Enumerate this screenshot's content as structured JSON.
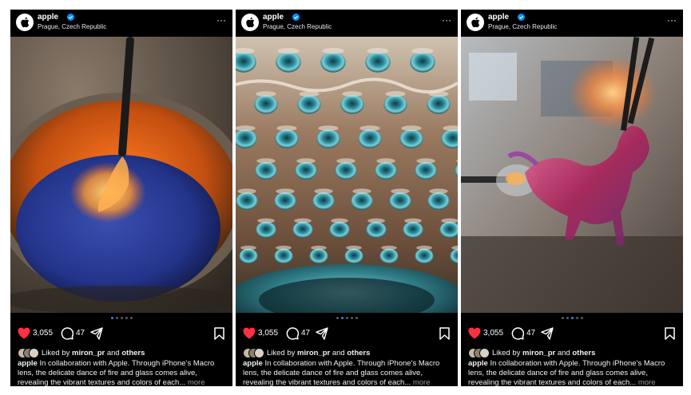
{
  "posts": [
    {
      "username": "apple",
      "location": "Prague, Czech Republic",
      "more_label": "···",
      "likes": "3,055",
      "comments": "47",
      "liked_prefix": "Liked by",
      "liked_user": "miron_pr",
      "liked_and": "and",
      "liked_others": "others",
      "caption_user": "apple",
      "caption_text": "In collaboration with Apple. Through iPhone’s Macro lens, the delicate dance of fire and glass comes alive, revealing the vibrant textures and colors of each...",
      "caption_more": "more",
      "photo": "molten-glass-in-blue-powder",
      "carousel_active": 1,
      "carousel_count": 5
    },
    {
      "username": "apple",
      "location": "Prague, Czech Republic",
      "more_label": "···",
      "likes": "3,055",
      "comments": "47",
      "liked_prefix": "Liked by",
      "liked_user": "miron_pr",
      "liked_and": "and",
      "liked_others": "others",
      "caption_user": "apple",
      "caption_text": "In collaboration with Apple. Through iPhone’s Macro lens, the delicate dance of fire and glass comes alive, revealing the vibrant textures and colors of each...",
      "caption_more": "more",
      "photo": "textured-glass-bubbles",
      "carousel_active": 2,
      "carousel_count": 5
    },
    {
      "username": "apple",
      "location": "Prague, Czech Republic",
      "more_label": "···",
      "likes": "3,055",
      "comments": "47",
      "liked_prefix": "Liked by",
      "liked_user": "miron_pr",
      "liked_and": "and",
      "liked_others": "others",
      "caption_user": "apple",
      "caption_text": "In collaboration with Apple. Through iPhone’s Macro lens, the delicate dance of fire and glass comes alive, revealing the vibrant textures and colors of each...",
      "caption_more": "more",
      "photo": "glass-horse-sculpture",
      "carousel_active": 3,
      "carousel_count": 5
    }
  ],
  "colors": {
    "post_background": "#000000",
    "like_red": "#ff3040",
    "verified_blue": "#0095f6",
    "carousel_active": "#2f86ff"
  },
  "icons": [
    "apple-logo-icon",
    "verified-badge-icon",
    "more-options-icon",
    "heart-icon",
    "comment-icon",
    "share-icon",
    "bookmark-icon"
  ]
}
